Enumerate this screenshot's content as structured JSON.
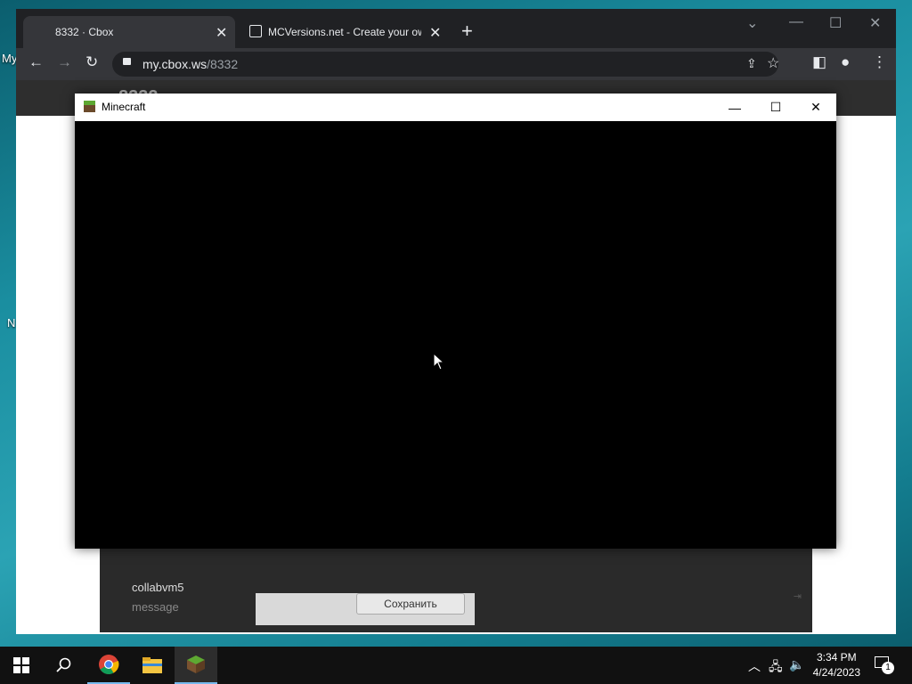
{
  "desktop": {
    "icon_labels": [
      "My",
      "N"
    ]
  },
  "browser": {
    "tabs": [
      {
        "label": "8332 · Cbox",
        "active": true
      },
      {
        "label": "MCVersions.net - Create your ow",
        "active": false
      }
    ],
    "new_tab": "+",
    "url_host": "my.cbox.ws",
    "url_path": "/8332"
  },
  "page": {
    "header_title": "8332",
    "chat_username": "collabvm5",
    "chat_message_placeholder": "message",
    "save_button": "Сохранить"
  },
  "minecraft": {
    "title": "Minecraft"
  },
  "taskbar": {
    "time": "3:34 PM",
    "date": "4/24/2023",
    "notification_count": "1"
  }
}
